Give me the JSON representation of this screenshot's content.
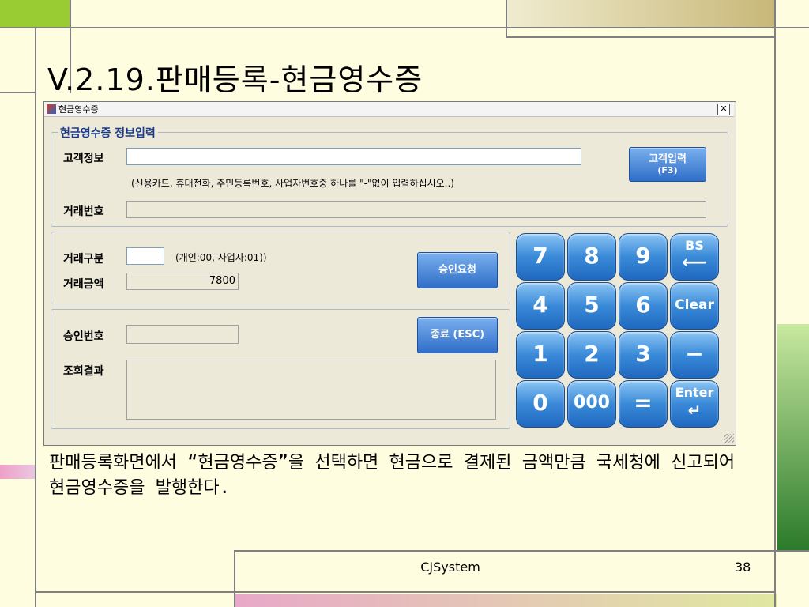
{
  "slide": {
    "title": "V.2.19.판매등록-현금영수증",
    "body_text": "판매등록화면에서 “현금영수증”을 선택하면 현금으로 결제된 금액만큼 국세청에 신고되어 현금영수증을 발행한다.",
    "footer_label": "CJSystem",
    "page_number": "38"
  },
  "window": {
    "title": "현금영수증",
    "close_glyph": "✕",
    "group_title": "현금영수증 정보입력",
    "customer_info_label": "고객정보",
    "customer_info_value": "",
    "hint": "(신용카드, 휴대전화, 주민등록번호, 사업자번호중 하나를 \"-\"없이 입력하십시오..)",
    "customer_input_button": "고객입력",
    "customer_input_button_sub": "(F3)",
    "transaction_no_label": "거래번호",
    "transaction_no_value": "",
    "trade_type_label": "거래구분",
    "trade_type_value": "",
    "trade_type_hint": "(개인:00, 사업자:01))",
    "trade_amount_label": "거래금액",
    "trade_amount_value": "7800",
    "approval_request_button": "승인요청",
    "approval_no_label": "승인번호",
    "approval_no_value": "",
    "exit_button": "종료 (ESC)",
    "result_label": "조회결과",
    "result_value": ""
  },
  "keypad": {
    "k7": "7",
    "k8": "8",
    "k9": "9",
    "bs": "BS",
    "bs_arrow": "⟵",
    "k4": "4",
    "k5": "5",
    "k6": "6",
    "clear": "Clear",
    "k1": "1",
    "k2": "2",
    "k3": "3",
    "minus": "−",
    "k0": "0",
    "k000": "000",
    "equals": "=",
    "enter": "Enter",
    "enter_arrow": "↵"
  }
}
